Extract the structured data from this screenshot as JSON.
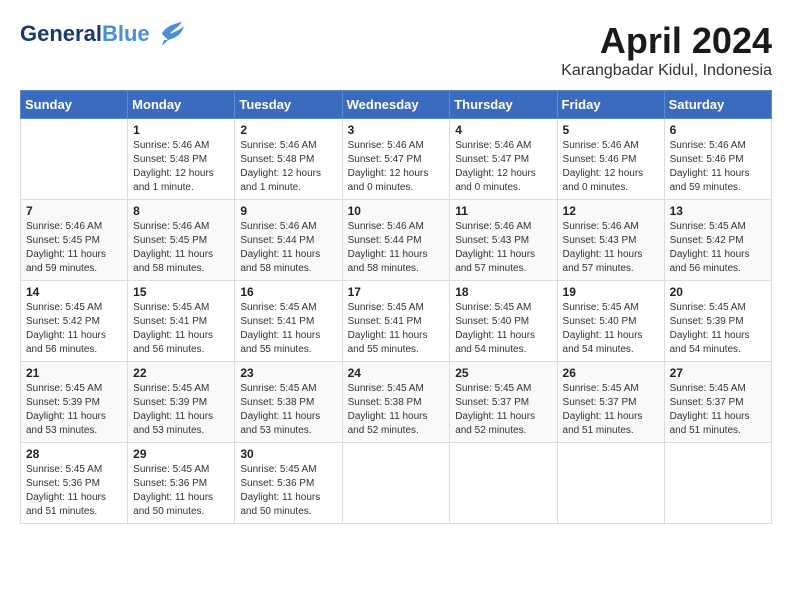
{
  "header": {
    "logo_line1": "General",
    "logo_line2": "Blue",
    "month_title": "April 2024",
    "location": "Karangbadar Kidul, Indonesia"
  },
  "weekdays": [
    "Sunday",
    "Monday",
    "Tuesday",
    "Wednesday",
    "Thursday",
    "Friday",
    "Saturday"
  ],
  "weeks": [
    [
      {
        "day": "",
        "sunrise": "",
        "sunset": "",
        "daylight": ""
      },
      {
        "day": "1",
        "sunrise": "Sunrise: 5:46 AM",
        "sunset": "Sunset: 5:48 PM",
        "daylight": "Daylight: 12 hours and 1 minute."
      },
      {
        "day": "2",
        "sunrise": "Sunrise: 5:46 AM",
        "sunset": "Sunset: 5:48 PM",
        "daylight": "Daylight: 12 hours and 1 minute."
      },
      {
        "day": "3",
        "sunrise": "Sunrise: 5:46 AM",
        "sunset": "Sunset: 5:47 PM",
        "daylight": "Daylight: 12 hours and 0 minutes."
      },
      {
        "day": "4",
        "sunrise": "Sunrise: 5:46 AM",
        "sunset": "Sunset: 5:47 PM",
        "daylight": "Daylight: 12 hours and 0 minutes."
      },
      {
        "day": "5",
        "sunrise": "Sunrise: 5:46 AM",
        "sunset": "Sunset: 5:46 PM",
        "daylight": "Daylight: 12 hours and 0 minutes."
      },
      {
        "day": "6",
        "sunrise": "Sunrise: 5:46 AM",
        "sunset": "Sunset: 5:46 PM",
        "daylight": "Daylight: 11 hours and 59 minutes."
      }
    ],
    [
      {
        "day": "7",
        "sunrise": "Sunrise: 5:46 AM",
        "sunset": "Sunset: 5:45 PM",
        "daylight": "Daylight: 11 hours and 59 minutes."
      },
      {
        "day": "8",
        "sunrise": "Sunrise: 5:46 AM",
        "sunset": "Sunset: 5:45 PM",
        "daylight": "Daylight: 11 hours and 58 minutes."
      },
      {
        "day": "9",
        "sunrise": "Sunrise: 5:46 AM",
        "sunset": "Sunset: 5:44 PM",
        "daylight": "Daylight: 11 hours and 58 minutes."
      },
      {
        "day": "10",
        "sunrise": "Sunrise: 5:46 AM",
        "sunset": "Sunset: 5:44 PM",
        "daylight": "Daylight: 11 hours and 58 minutes."
      },
      {
        "day": "11",
        "sunrise": "Sunrise: 5:46 AM",
        "sunset": "Sunset: 5:43 PM",
        "daylight": "Daylight: 11 hours and 57 minutes."
      },
      {
        "day": "12",
        "sunrise": "Sunrise: 5:46 AM",
        "sunset": "Sunset: 5:43 PM",
        "daylight": "Daylight: 11 hours and 57 minutes."
      },
      {
        "day": "13",
        "sunrise": "Sunrise: 5:45 AM",
        "sunset": "Sunset: 5:42 PM",
        "daylight": "Daylight: 11 hours and 56 minutes."
      }
    ],
    [
      {
        "day": "14",
        "sunrise": "Sunrise: 5:45 AM",
        "sunset": "Sunset: 5:42 PM",
        "daylight": "Daylight: 11 hours and 56 minutes."
      },
      {
        "day": "15",
        "sunrise": "Sunrise: 5:45 AM",
        "sunset": "Sunset: 5:41 PM",
        "daylight": "Daylight: 11 hours and 56 minutes."
      },
      {
        "day": "16",
        "sunrise": "Sunrise: 5:45 AM",
        "sunset": "Sunset: 5:41 PM",
        "daylight": "Daylight: 11 hours and 55 minutes."
      },
      {
        "day": "17",
        "sunrise": "Sunrise: 5:45 AM",
        "sunset": "Sunset: 5:41 PM",
        "daylight": "Daylight: 11 hours and 55 minutes."
      },
      {
        "day": "18",
        "sunrise": "Sunrise: 5:45 AM",
        "sunset": "Sunset: 5:40 PM",
        "daylight": "Daylight: 11 hours and 54 minutes."
      },
      {
        "day": "19",
        "sunrise": "Sunrise: 5:45 AM",
        "sunset": "Sunset: 5:40 PM",
        "daylight": "Daylight: 11 hours and 54 minutes."
      },
      {
        "day": "20",
        "sunrise": "Sunrise: 5:45 AM",
        "sunset": "Sunset: 5:39 PM",
        "daylight": "Daylight: 11 hours and 54 minutes."
      }
    ],
    [
      {
        "day": "21",
        "sunrise": "Sunrise: 5:45 AM",
        "sunset": "Sunset: 5:39 PM",
        "daylight": "Daylight: 11 hours and 53 minutes."
      },
      {
        "day": "22",
        "sunrise": "Sunrise: 5:45 AM",
        "sunset": "Sunset: 5:39 PM",
        "daylight": "Daylight: 11 hours and 53 minutes."
      },
      {
        "day": "23",
        "sunrise": "Sunrise: 5:45 AM",
        "sunset": "Sunset: 5:38 PM",
        "daylight": "Daylight: 11 hours and 53 minutes."
      },
      {
        "day": "24",
        "sunrise": "Sunrise: 5:45 AM",
        "sunset": "Sunset: 5:38 PM",
        "daylight": "Daylight: 11 hours and 52 minutes."
      },
      {
        "day": "25",
        "sunrise": "Sunrise: 5:45 AM",
        "sunset": "Sunset: 5:37 PM",
        "daylight": "Daylight: 11 hours and 52 minutes."
      },
      {
        "day": "26",
        "sunrise": "Sunrise: 5:45 AM",
        "sunset": "Sunset: 5:37 PM",
        "daylight": "Daylight: 11 hours and 51 minutes."
      },
      {
        "day": "27",
        "sunrise": "Sunrise: 5:45 AM",
        "sunset": "Sunset: 5:37 PM",
        "daylight": "Daylight: 11 hours and 51 minutes."
      }
    ],
    [
      {
        "day": "28",
        "sunrise": "Sunrise: 5:45 AM",
        "sunset": "Sunset: 5:36 PM",
        "daylight": "Daylight: 11 hours and 51 minutes."
      },
      {
        "day": "29",
        "sunrise": "Sunrise: 5:45 AM",
        "sunset": "Sunset: 5:36 PM",
        "daylight": "Daylight: 11 hours and 50 minutes."
      },
      {
        "day": "30",
        "sunrise": "Sunrise: 5:45 AM",
        "sunset": "Sunset: 5:36 PM",
        "daylight": "Daylight: 11 hours and 50 minutes."
      },
      {
        "day": "",
        "sunrise": "",
        "sunset": "",
        "daylight": ""
      },
      {
        "day": "",
        "sunrise": "",
        "sunset": "",
        "daylight": ""
      },
      {
        "day": "",
        "sunrise": "",
        "sunset": "",
        "daylight": ""
      },
      {
        "day": "",
        "sunrise": "",
        "sunset": "",
        "daylight": ""
      }
    ]
  ]
}
